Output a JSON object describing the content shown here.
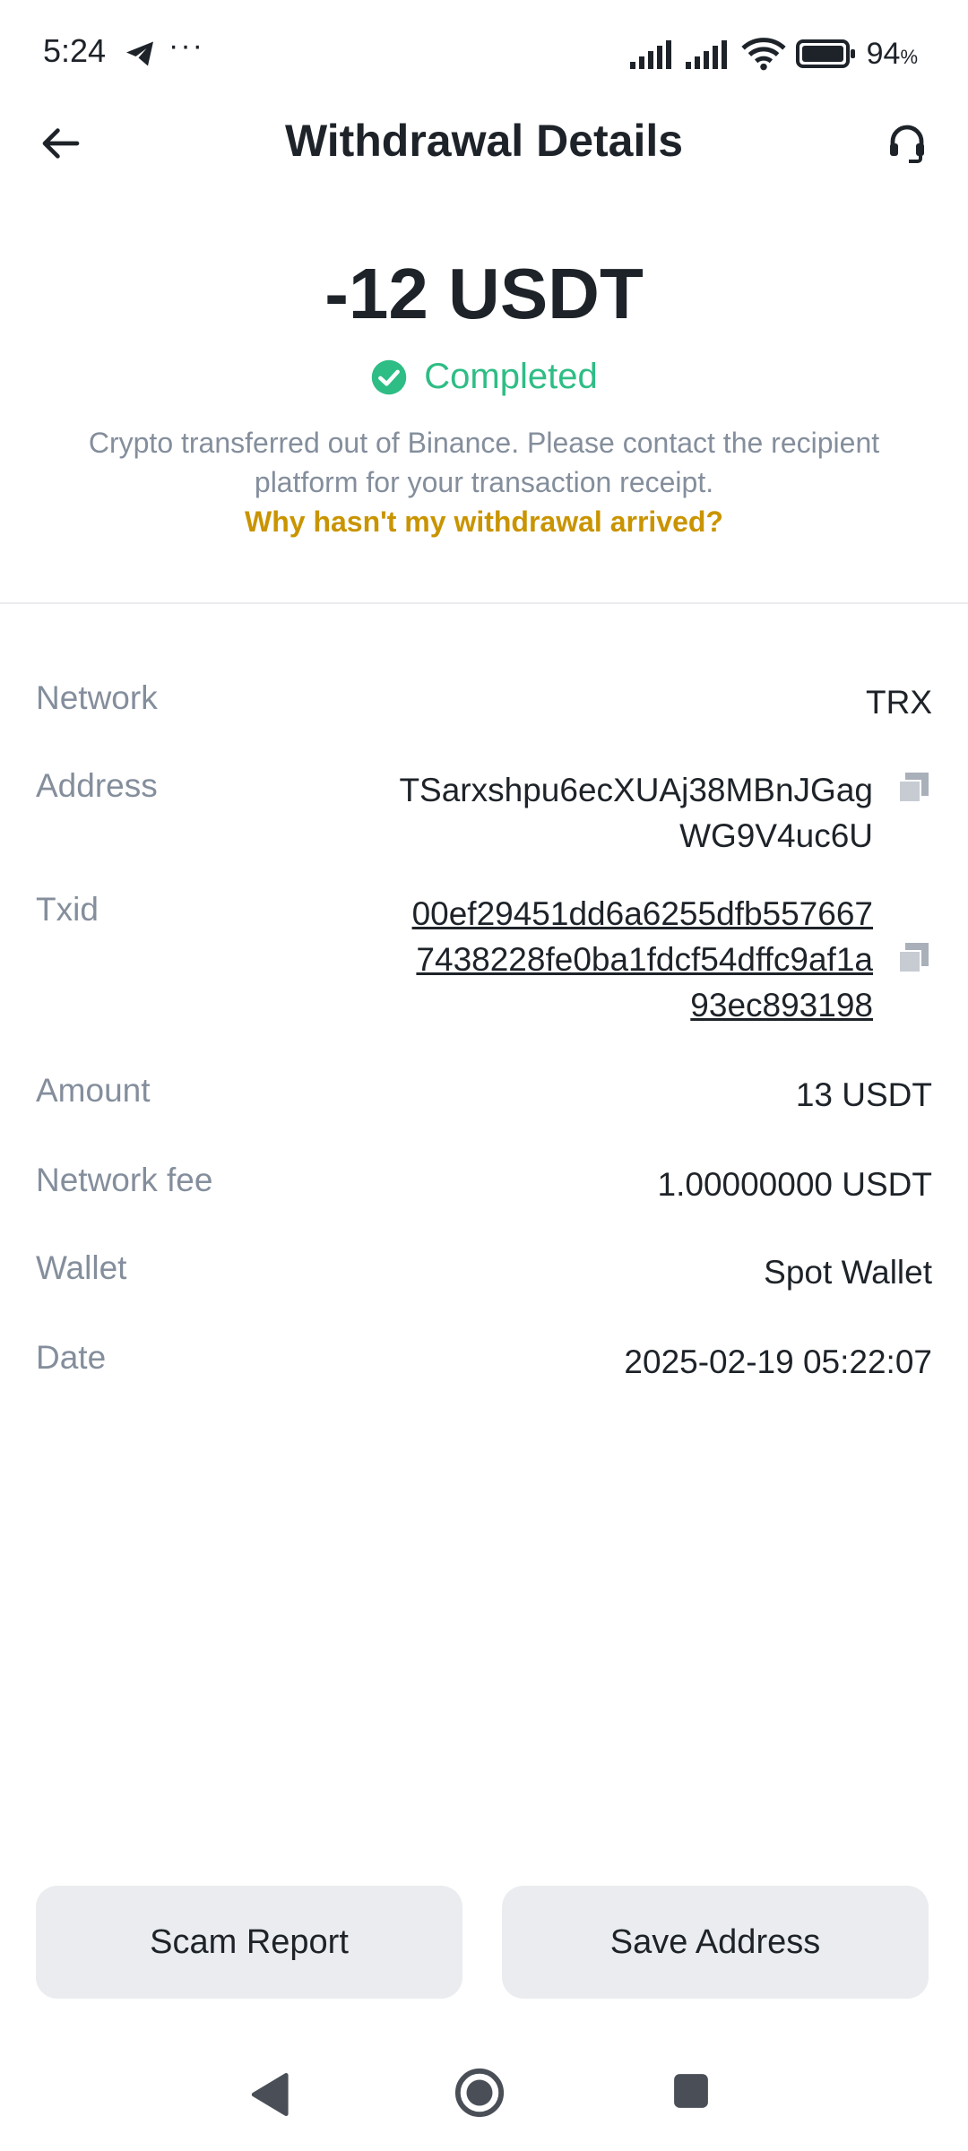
{
  "status_bar": {
    "time": "5:24",
    "dots": "···",
    "battery_percent": "94",
    "battery_unit": "%"
  },
  "header": {
    "title": "Withdrawal Details"
  },
  "summary": {
    "amount": "-12 USDT",
    "status": "Completed",
    "info": "Crypto transferred out of Binance. Please contact the recipient platform for your transaction receipt.",
    "help_link": "Why hasn't my withdrawal arrived?"
  },
  "details": {
    "network": {
      "label": "Network",
      "value": "TRX"
    },
    "address": {
      "label": "Address",
      "value_line1": "TSarxshpu6ecXUAj38MBnJGag",
      "value_line2": "WG9V4uc6U"
    },
    "txid": {
      "label": "Txid",
      "value_line1": "00ef29451dd6a6255dfb557667",
      "value_line2": "7438228fe0ba1fdcf54dffc9af1a",
      "value_line3": "93ec893198"
    },
    "amount": {
      "label": "Amount",
      "value": "13 USDT"
    },
    "network_fee": {
      "label": "Network fee",
      "value": "1.00000000 USDT"
    },
    "wallet": {
      "label": "Wallet",
      "value": "Spot Wallet"
    },
    "date": {
      "label": "Date",
      "value": "2025-02-19 05:22:07"
    }
  },
  "actions": {
    "scam_report": "Scam Report",
    "save_address": "Save Address"
  },
  "colors": {
    "success": "#2ebd85",
    "link": "#c99400",
    "muted": "#848e9c",
    "text": "#1e2329",
    "button_bg": "#eaecef"
  }
}
